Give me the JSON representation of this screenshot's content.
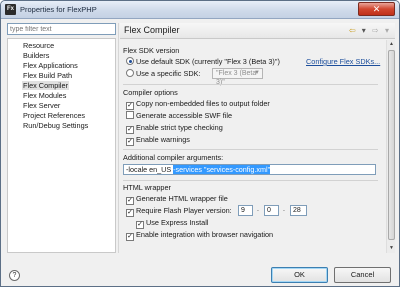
{
  "window": {
    "title": "Properties for FlexPHP",
    "icon_text": "Fx",
    "close_glyph": "✕"
  },
  "sidebar": {
    "filter_placeholder": "type filter text",
    "items": [
      {
        "label": "Resource",
        "selected": false
      },
      {
        "label": "Builders",
        "selected": false
      },
      {
        "label": "Flex Applications",
        "selected": false
      },
      {
        "label": "Flex Build Path",
        "selected": false
      },
      {
        "label": "Flex Compiler",
        "selected": true
      },
      {
        "label": "Flex Modules",
        "selected": false
      },
      {
        "label": "Flex Server",
        "selected": false
      },
      {
        "label": "Project References",
        "selected": false
      },
      {
        "label": "Run/Debug Settings",
        "selected": false
      }
    ]
  },
  "page": {
    "title": "Flex Compiler",
    "nav_back": "⇦",
    "nav_back_menu": "▾",
    "nav_fwd": "⇨",
    "nav_fwd_menu": "▾"
  },
  "sdk": {
    "section_label": "Flex SDK version",
    "default_label": "Use default SDK (currently \"Flex 3 (Beta 3)\")",
    "specific_label": "Use a specific SDK:",
    "specific_value": "\"Flex 3 (Beta 3)\"",
    "configure_link": "Configure Flex SDKs..."
  },
  "compiler_options": {
    "section_label": "Compiler options",
    "copy_non_embedded": {
      "label": "Copy non-embedded files to output folder",
      "checked": true
    },
    "accessible_swf": {
      "label": "Generate accessible SWF file",
      "checked": false
    },
    "strict_type": {
      "label": "Enable strict type checking",
      "checked": true
    },
    "warnings": {
      "label": "Enable warnings",
      "checked": true
    }
  },
  "additional_args": {
    "label": "Additional compiler arguments:",
    "value_plain": "-locale en_US ",
    "value_selected": "-services \"services-config.xml\""
  },
  "html_wrapper": {
    "section_label": "HTML wrapper",
    "generate": {
      "label": "Generate HTML wrapper file",
      "checked": true
    },
    "require_flash": {
      "label": "Require Flash Player version:",
      "checked": true
    },
    "version": {
      "major": "9",
      "minor": "0",
      "revision": "28"
    },
    "express_install": {
      "label": "Use Express Install",
      "checked": true
    },
    "browser_nav": {
      "label": "Enable integration with browser navigation",
      "checked": true
    }
  },
  "footer": {
    "help_glyph": "?",
    "ok_label": "OK",
    "cancel_label": "Cancel"
  }
}
